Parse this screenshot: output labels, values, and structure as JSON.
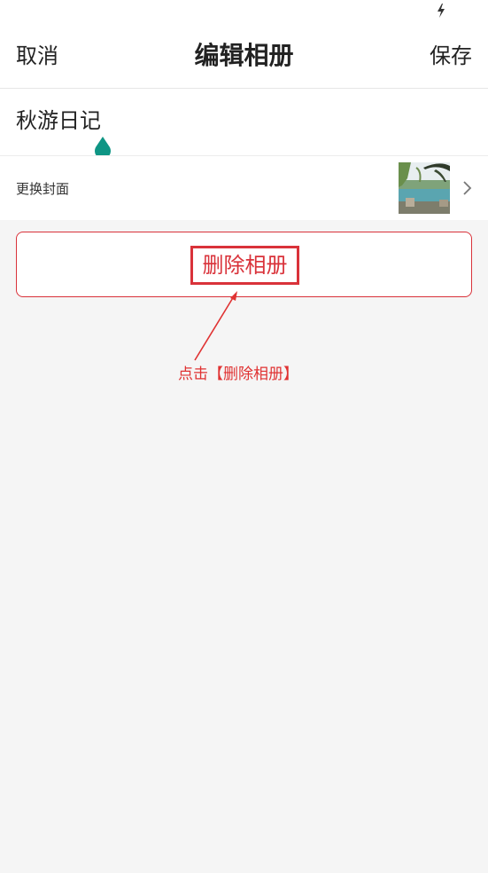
{
  "status_bar": {
    "icon": "lightning-bolt-icon"
  },
  "nav": {
    "cancel_label": "取消",
    "title": "编辑相册",
    "save_label": "保存"
  },
  "album": {
    "name_value": "秋游日记",
    "cover_label": "更换封面",
    "cover_image": "lake-willow-landscape-thumbnail"
  },
  "actions": {
    "delete_label": "删除相册"
  },
  "annotation": {
    "text": "点击【删除相册】",
    "color": "#e03232"
  },
  "colors": {
    "accent_danger": "#d9323a",
    "handle_teal": "#0e9584",
    "background": "#f5f5f5"
  }
}
